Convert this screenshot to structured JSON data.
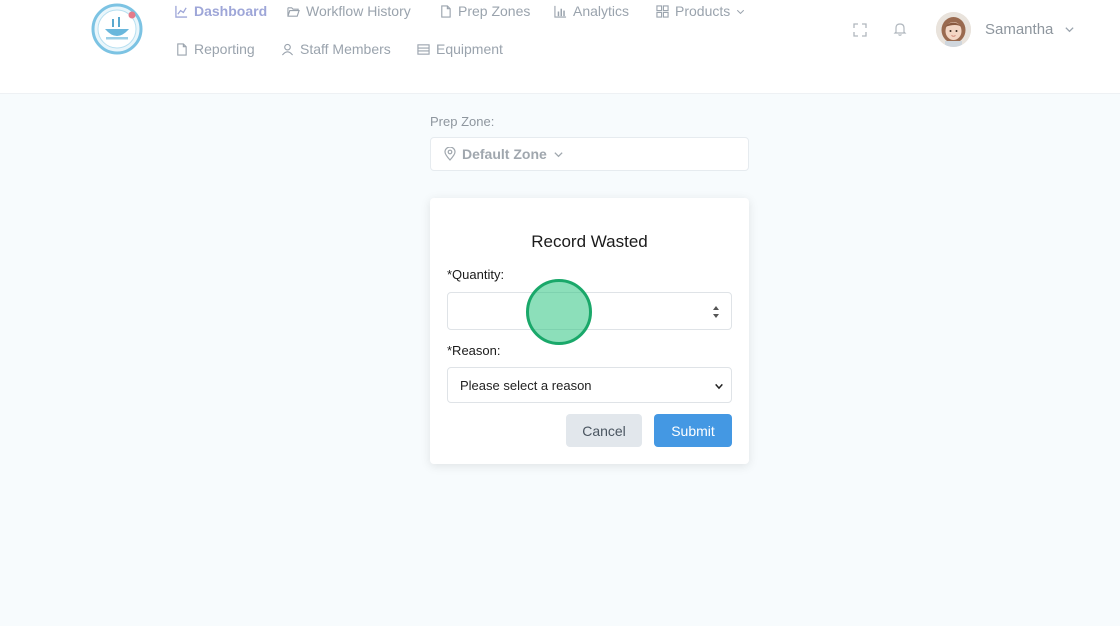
{
  "nav": {
    "row1": [
      {
        "label": "Dashboard",
        "icon": "chart-line-icon",
        "active": true
      },
      {
        "label": "Workflow History",
        "icon": "folder-open-icon"
      },
      {
        "label": "Prep Zones",
        "icon": "file-icon"
      },
      {
        "label": "Analytics",
        "icon": "bar-chart-icon"
      },
      {
        "label": "Products",
        "icon": "grid-icon"
      }
    ],
    "row2": [
      {
        "label": "Reporting",
        "icon": "file-icon"
      },
      {
        "label": "Staff Members",
        "icon": "user-icon"
      },
      {
        "label": "Equipment",
        "icon": "list-icon"
      }
    ]
  },
  "header": {
    "user_name": "Samantha",
    "icons": [
      "fullscreen-icon",
      "bell-icon",
      "chevron-down-icon"
    ]
  },
  "prep_zone": {
    "label": "Prep Zone:",
    "value": "Default Zone"
  },
  "modal": {
    "title": "Record Wasted",
    "quantity_label": "*Quantity:",
    "quantity_value": "",
    "reason_label": "*Reason:",
    "reason_selected": "Please select a reason",
    "cancel_label": "Cancel",
    "submit_label": "Submit"
  },
  "colors": {
    "accent": "#4498e3",
    "nav_active": "#9ea6d8",
    "click_indicator": "#1aa86a"
  }
}
